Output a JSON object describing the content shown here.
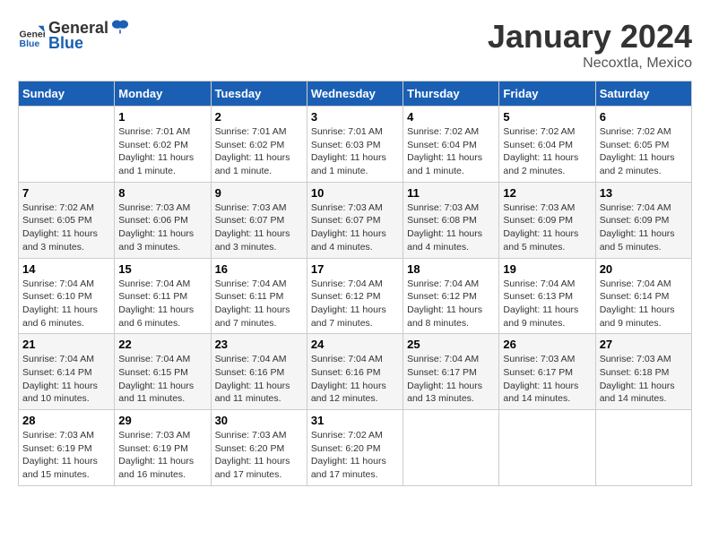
{
  "header": {
    "logo_general": "General",
    "logo_blue": "Blue",
    "month": "January 2024",
    "location": "Necoxtla, Mexico"
  },
  "weekdays": [
    "Sunday",
    "Monday",
    "Tuesday",
    "Wednesday",
    "Thursday",
    "Friday",
    "Saturday"
  ],
  "weeks": [
    [
      {
        "day": "",
        "info": ""
      },
      {
        "day": "1",
        "info": "Sunrise: 7:01 AM\nSunset: 6:02 PM\nDaylight: 11 hours and 1 minute."
      },
      {
        "day": "2",
        "info": "Sunrise: 7:01 AM\nSunset: 6:02 PM\nDaylight: 11 hours and 1 minute."
      },
      {
        "day": "3",
        "info": "Sunrise: 7:01 AM\nSunset: 6:03 PM\nDaylight: 11 hours and 1 minute."
      },
      {
        "day": "4",
        "info": "Sunrise: 7:02 AM\nSunset: 6:04 PM\nDaylight: 11 hours and 1 minute."
      },
      {
        "day": "5",
        "info": "Sunrise: 7:02 AM\nSunset: 6:04 PM\nDaylight: 11 hours and 2 minutes."
      },
      {
        "day": "6",
        "info": "Sunrise: 7:02 AM\nSunset: 6:05 PM\nDaylight: 11 hours and 2 minutes."
      }
    ],
    [
      {
        "day": "7",
        "info": "Sunrise: 7:02 AM\nSunset: 6:05 PM\nDaylight: 11 hours and 3 minutes."
      },
      {
        "day": "8",
        "info": "Sunrise: 7:03 AM\nSunset: 6:06 PM\nDaylight: 11 hours and 3 minutes."
      },
      {
        "day": "9",
        "info": "Sunrise: 7:03 AM\nSunset: 6:07 PM\nDaylight: 11 hours and 3 minutes."
      },
      {
        "day": "10",
        "info": "Sunrise: 7:03 AM\nSunset: 6:07 PM\nDaylight: 11 hours and 4 minutes."
      },
      {
        "day": "11",
        "info": "Sunrise: 7:03 AM\nSunset: 6:08 PM\nDaylight: 11 hours and 4 minutes."
      },
      {
        "day": "12",
        "info": "Sunrise: 7:03 AM\nSunset: 6:09 PM\nDaylight: 11 hours and 5 minutes."
      },
      {
        "day": "13",
        "info": "Sunrise: 7:04 AM\nSunset: 6:09 PM\nDaylight: 11 hours and 5 minutes."
      }
    ],
    [
      {
        "day": "14",
        "info": "Sunrise: 7:04 AM\nSunset: 6:10 PM\nDaylight: 11 hours and 6 minutes."
      },
      {
        "day": "15",
        "info": "Sunrise: 7:04 AM\nSunset: 6:11 PM\nDaylight: 11 hours and 6 minutes."
      },
      {
        "day": "16",
        "info": "Sunrise: 7:04 AM\nSunset: 6:11 PM\nDaylight: 11 hours and 7 minutes."
      },
      {
        "day": "17",
        "info": "Sunrise: 7:04 AM\nSunset: 6:12 PM\nDaylight: 11 hours and 7 minutes."
      },
      {
        "day": "18",
        "info": "Sunrise: 7:04 AM\nSunset: 6:12 PM\nDaylight: 11 hours and 8 minutes."
      },
      {
        "day": "19",
        "info": "Sunrise: 7:04 AM\nSunset: 6:13 PM\nDaylight: 11 hours and 9 minutes."
      },
      {
        "day": "20",
        "info": "Sunrise: 7:04 AM\nSunset: 6:14 PM\nDaylight: 11 hours and 9 minutes."
      }
    ],
    [
      {
        "day": "21",
        "info": "Sunrise: 7:04 AM\nSunset: 6:14 PM\nDaylight: 11 hours and 10 minutes."
      },
      {
        "day": "22",
        "info": "Sunrise: 7:04 AM\nSunset: 6:15 PM\nDaylight: 11 hours and 11 minutes."
      },
      {
        "day": "23",
        "info": "Sunrise: 7:04 AM\nSunset: 6:16 PM\nDaylight: 11 hours and 11 minutes."
      },
      {
        "day": "24",
        "info": "Sunrise: 7:04 AM\nSunset: 6:16 PM\nDaylight: 11 hours and 12 minutes."
      },
      {
        "day": "25",
        "info": "Sunrise: 7:04 AM\nSunset: 6:17 PM\nDaylight: 11 hours and 13 minutes."
      },
      {
        "day": "26",
        "info": "Sunrise: 7:03 AM\nSunset: 6:17 PM\nDaylight: 11 hours and 14 minutes."
      },
      {
        "day": "27",
        "info": "Sunrise: 7:03 AM\nSunset: 6:18 PM\nDaylight: 11 hours and 14 minutes."
      }
    ],
    [
      {
        "day": "28",
        "info": "Sunrise: 7:03 AM\nSunset: 6:19 PM\nDaylight: 11 hours and 15 minutes."
      },
      {
        "day": "29",
        "info": "Sunrise: 7:03 AM\nSunset: 6:19 PM\nDaylight: 11 hours and 16 minutes."
      },
      {
        "day": "30",
        "info": "Sunrise: 7:03 AM\nSunset: 6:20 PM\nDaylight: 11 hours and 17 minutes."
      },
      {
        "day": "31",
        "info": "Sunrise: 7:02 AM\nSunset: 6:20 PM\nDaylight: 11 hours and 17 minutes."
      },
      {
        "day": "",
        "info": ""
      },
      {
        "day": "",
        "info": ""
      },
      {
        "day": "",
        "info": ""
      }
    ]
  ]
}
